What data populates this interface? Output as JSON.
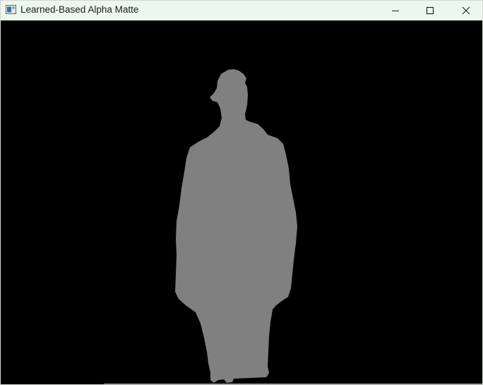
{
  "window": {
    "title": "Learned-Based Alpha Matte",
    "titlebar_color": "#ecf8ee"
  },
  "titlebar_controls": {
    "minimize_icon": "minimize-icon",
    "maximize_icon": "maximize-icon",
    "close_icon": "close-icon"
  },
  "canvas": {
    "background_color": "#000000",
    "foreground_color": "#808080"
  }
}
